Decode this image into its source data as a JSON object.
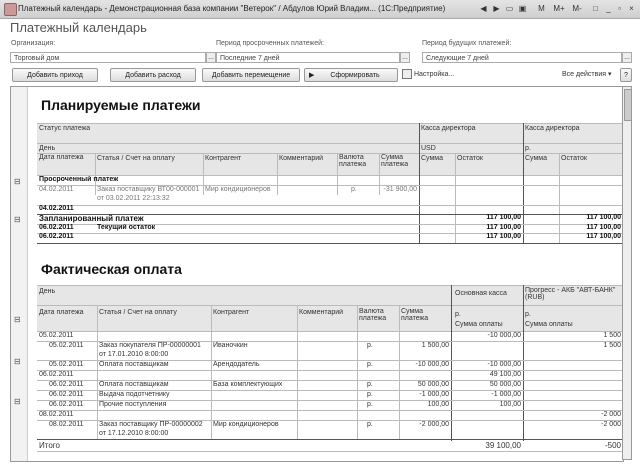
{
  "window": {
    "title": "Платежный календарь - Демонстрационная база компании \"Ветерок\" / Абдулов Юрий Владим... (1С:Предприятие)",
    "controls": [
      "◀",
      "▶",
      "▭",
      "▣",
      "M",
      "M+",
      "M-",
      "□",
      "_",
      "▫",
      "×"
    ]
  },
  "form": {
    "title": "Платежный календарь",
    "org_label": "Организация:",
    "org_value": "Торговый дом",
    "overdue_label": "Период просроченных платежей:",
    "overdue_value": "Последние 7 дней",
    "future_label": "Период будущих платежей:",
    "future_value": "Следующие 7 дней",
    "select_btn": "...",
    "toolbar": {
      "add_income": "Добавить приход",
      "add_expense": "Добавить расход",
      "add_transfer": "Добавить перемещение",
      "generate": "Сформировать",
      "settings": "Настройка...",
      "all_actions": "Все действия ▾",
      "help": "?"
    }
  },
  "planned": {
    "heading": "Планируемые платежи",
    "h_status": "Статус платежа",
    "h_day": "День",
    "h_date": "Дата платежа",
    "h_item": "Статья / Счет на оплату",
    "h_contractor": "Контрагент",
    "h_comment": "Комментарий",
    "h_currency": "Валюта платежа",
    "h_amount": "Сумма платежа",
    "acc1": "Касса директора",
    "acc1_cur": "USD",
    "acc2": "Касса директора",
    "acc2_cur": "р.",
    "h_sum": "Сумма",
    "h_rest": "Остаток",
    "overdue_label": "Просроченный платеж",
    "od_date": "04.02.2011",
    "od_item1": "Заказ поставщику ВТ00-000001",
    "od_item2": "от 03.02.2011 22:13:32",
    "od_contractor": "Мир кондиционеров",
    "od_currency": "р.",
    "od_amount": "-31 900,00",
    "day1": "04.02.2011",
    "scheduled_label": "Запланированный платеж",
    "sched_rest1": "117 100,00",
    "sched_rest2": "117 100,00",
    "day2": "06.02.2011",
    "current_label": "Текущий остаток",
    "cur_rest1": "117 100,00",
    "cur_rest2": "117 100,00",
    "day3": "06.02.2011",
    "d3_rest1": "117 100,00",
    "d3_rest2": "117 100,00"
  },
  "actual": {
    "heading": "Фактическая оплата",
    "h_day": "День",
    "h_date": "Дата платежа",
    "h_item": "Статья / Счет на оплату",
    "h_contractor": "Контрагент",
    "h_comment": "Комментарий",
    "h_currency": "Валюта платежа",
    "h_amount": "Сумма платежа",
    "acc1": "Основная касса",
    "acc2": "Прогресс - АКБ \"АВТ-БАНК\" (RUB)",
    "acc1_cur": "р.",
    "acc2_cur": "р.",
    "h_paid": "Сумма оплаты",
    "rows": [
      {
        "day": "05.02.2011",
        "bold": true,
        "c1": "-10 000,00",
        "c2": "1 500"
      },
      {
        "date": "05.02.2011",
        "item": "Заказ покупателя ПР-00000001",
        "contractor": "Иваночкин",
        "currency": "р.",
        "amount": "1 500,00",
        "c2": "1 500"
      },
      {
        "item": "от 17.01.2010 8:00:00",
        "cont": true
      },
      {
        "date": "05.02.2011",
        "item": "Оплата поставщикам",
        "contractor": "Арендодатель",
        "currency": "р.",
        "amount": "-10 000,00",
        "c1": "-10 000,00"
      },
      {
        "day": "06.02.2011",
        "bold": true,
        "c1": "49 100,00"
      },
      {
        "date": "06.02.2011",
        "item": "Оплата поставщикам",
        "contractor": "База комплектующих",
        "currency": "р.",
        "amount": "50 000,00",
        "c1": "50 000,00"
      },
      {
        "date": "06.02.2011",
        "item": "Выдача подотчетнику",
        "currency": "р.",
        "amount": "-1 000,00",
        "c1": "-1 000,00"
      },
      {
        "date": "06.02.2011",
        "item": "Прочие поступления",
        "currency": "р.",
        "amount": "100,00",
        "c1": "100,00"
      },
      {
        "day": "08.02.2011",
        "bold": true,
        "c2": "-2 000"
      },
      {
        "date": "08.02.2011",
        "item": "Заказ поставщику ПР-00000002",
        "contractor": "Мир кондиционеров",
        "currency": "р.",
        "amount": "-2 000,00",
        "c2": "-2 000"
      },
      {
        "item": "от 17.12.2010 8:00:00",
        "cont": true
      }
    ],
    "total_label": "Итого",
    "total1": "39 100,00",
    "total2": "-500"
  }
}
